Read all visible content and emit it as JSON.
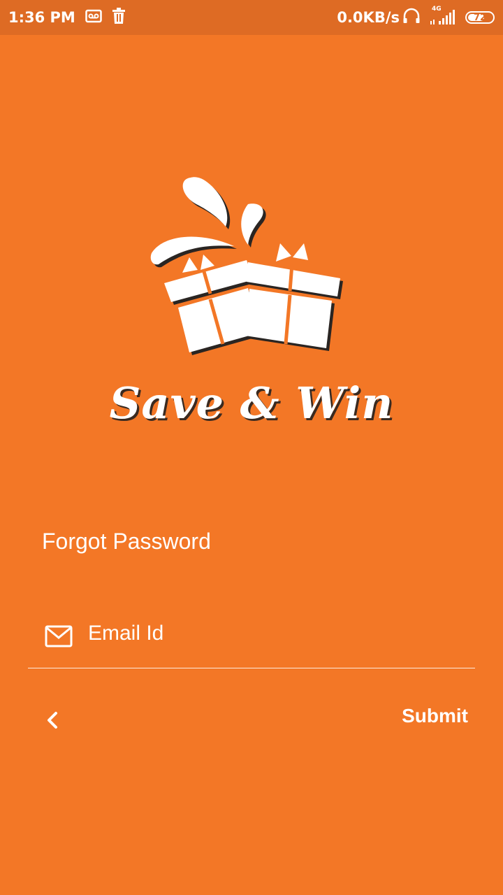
{
  "status_bar": {
    "time": "1:36 PM",
    "network_speed": "0.0KB/s",
    "network_type": "4G",
    "battery": "72",
    "battery_level": 0.72,
    "icons": [
      "voicemail-icon",
      "trash-icon",
      "headset-icon",
      "signal-icon",
      "battery-icon"
    ]
  },
  "brand": {
    "logo_icon": "gift-boxes-icon",
    "name": "Save & Win"
  },
  "page": {
    "title": "Forgot Password"
  },
  "form": {
    "email_icon": "mail-icon",
    "email_placeholder": "Email Id",
    "email_value": ""
  },
  "actions": {
    "back_icon": "chevron-left-icon",
    "submit_label": "Submit"
  },
  "colors": {
    "background": "#f37726",
    "status_bar": "#de6b24",
    "text": "#ffffff"
  }
}
